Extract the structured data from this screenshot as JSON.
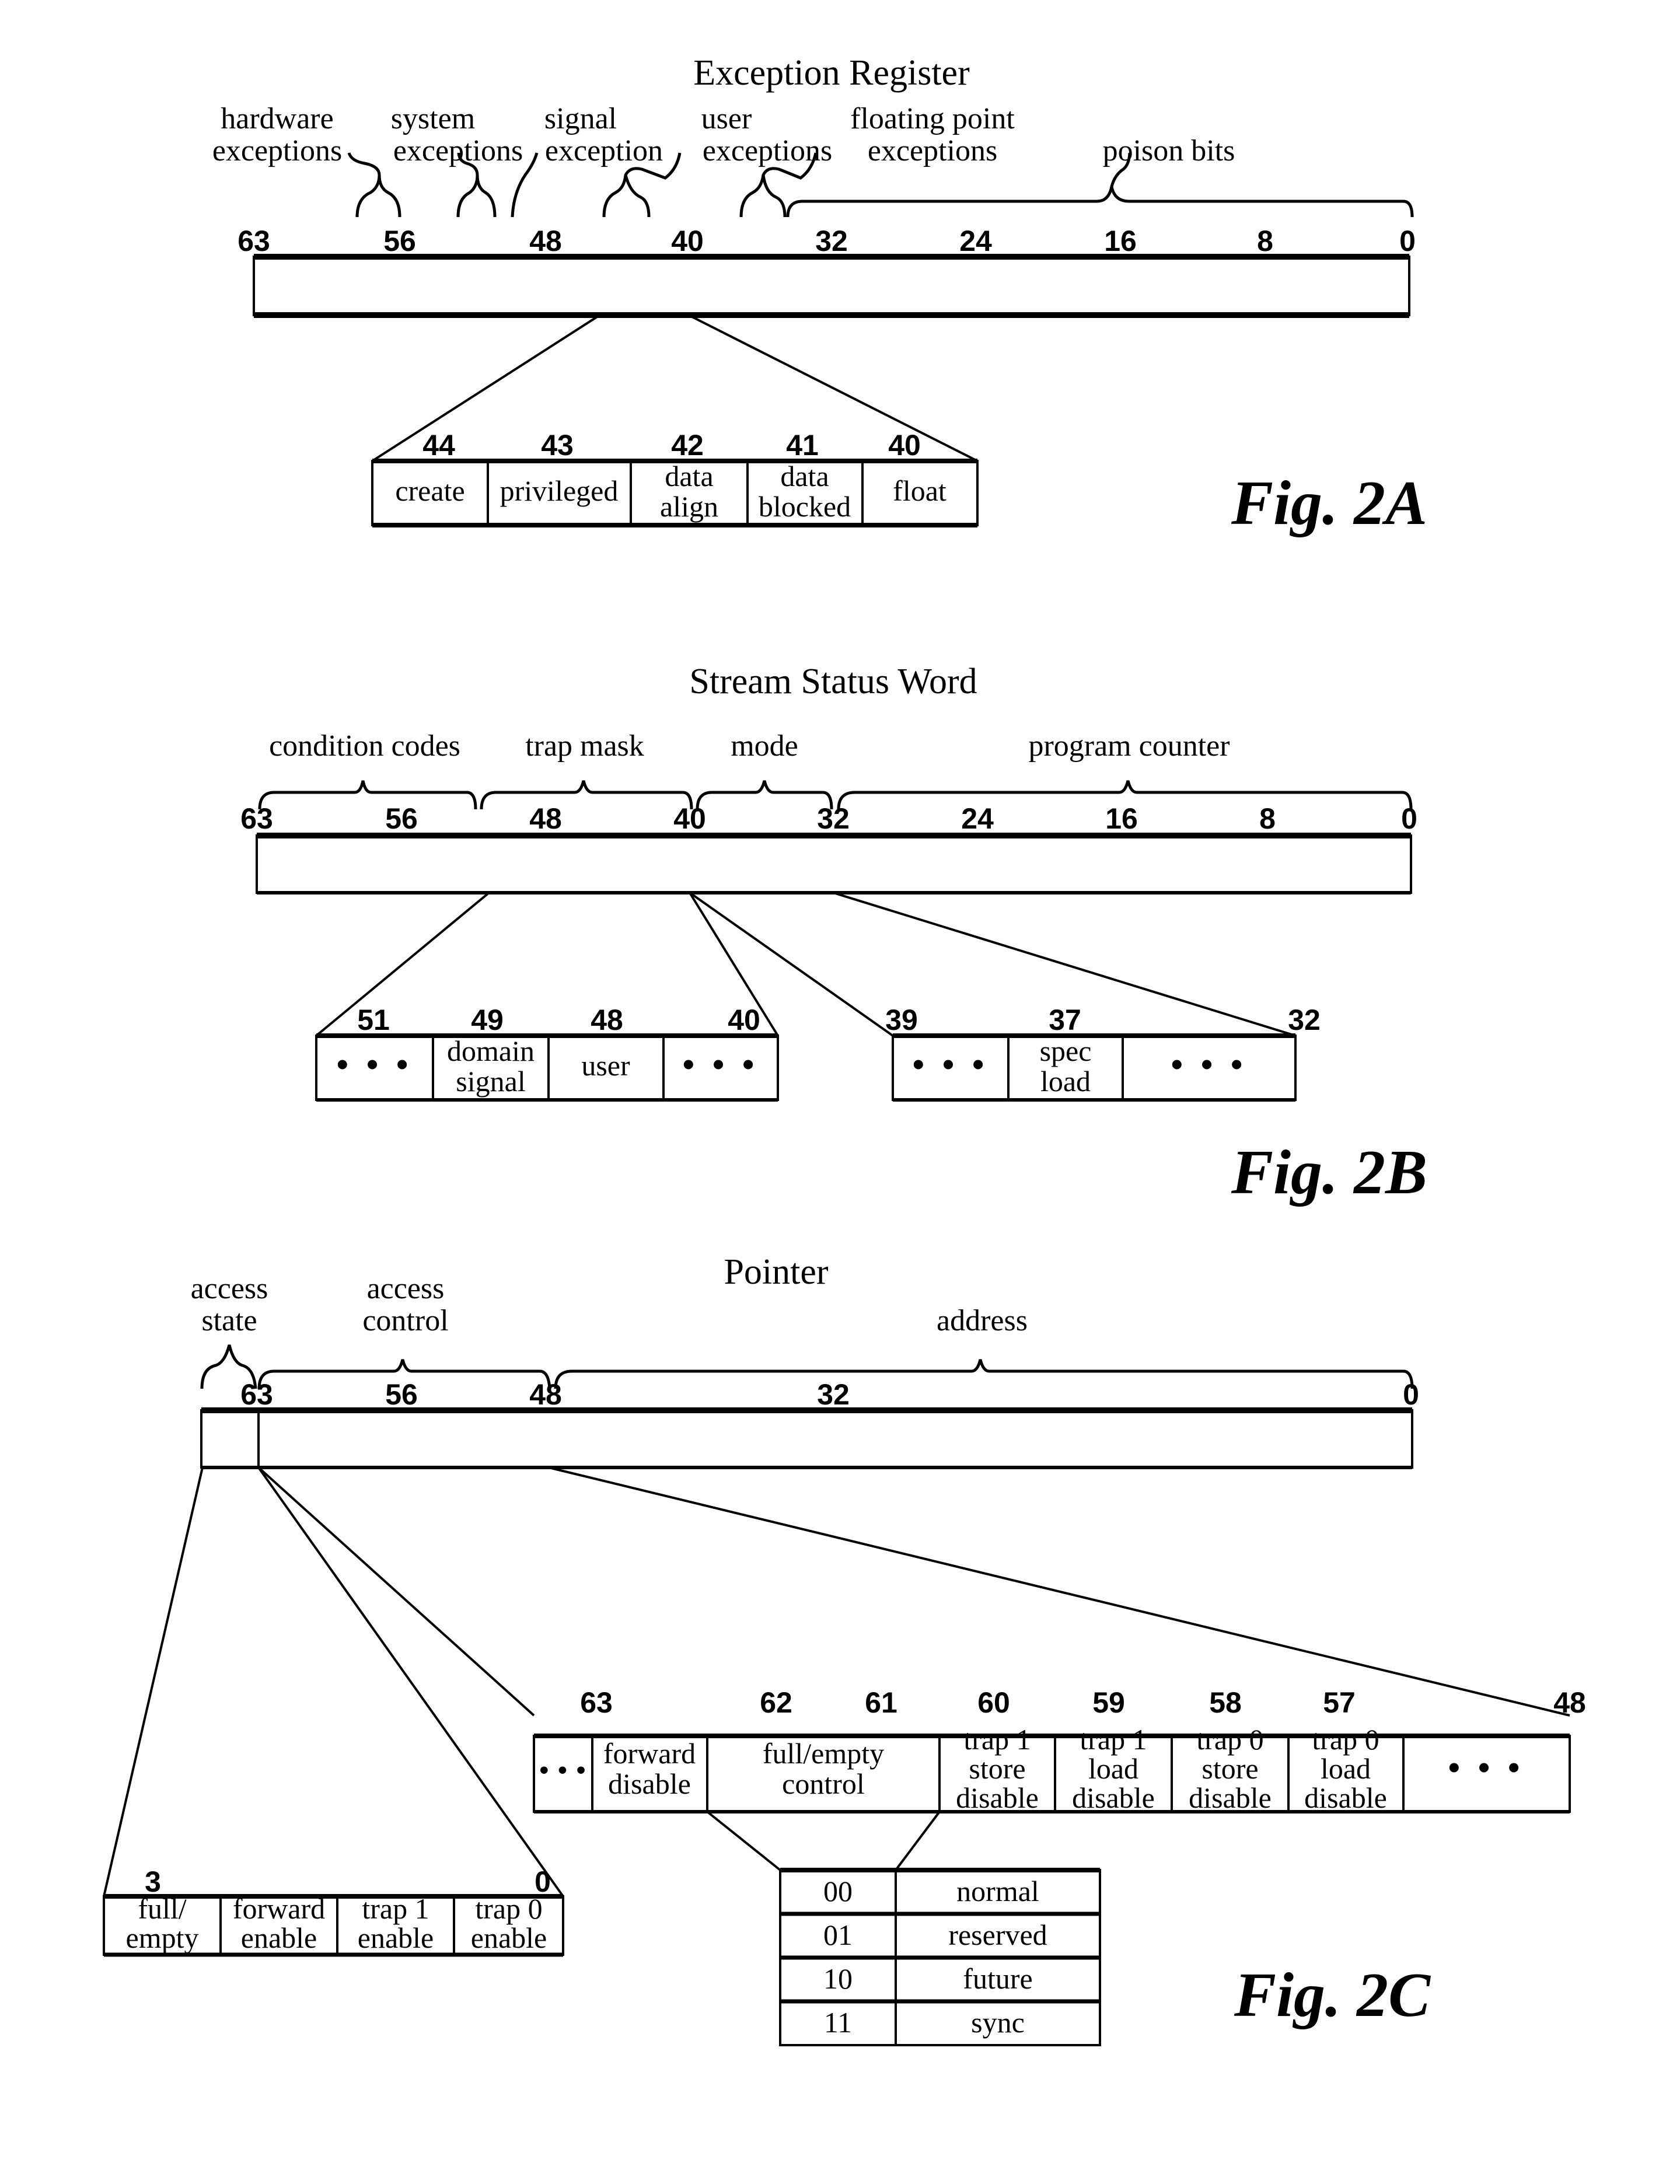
{
  "fig2a": {
    "title": "Exception Register",
    "caption": "Fig. 2A",
    "field_labels": [
      {
        "line1": "hardware",
        "line2": "exceptions"
      },
      {
        "line1": "system",
        "line2": "exceptions"
      },
      {
        "line1": "signal",
        "line2": "exception"
      },
      {
        "line1": "user",
        "line2": "exceptions"
      },
      {
        "line1": "floating point",
        "line2": "exceptions"
      },
      {
        "line1": "",
        "line2": "poison bits"
      }
    ],
    "bit_ticks": [
      "63",
      "56",
      "48",
      "40",
      "32",
      "24",
      "16",
      "8",
      "0"
    ],
    "detail": {
      "bits": [
        "44",
        "43",
        "42",
        "41",
        "40"
      ],
      "cells": [
        {
          "line1": "create",
          "line2": ""
        },
        {
          "line1": "privileged",
          "line2": ""
        },
        {
          "line1": "data",
          "line2": "align"
        },
        {
          "line1": "data",
          "line2": "blocked"
        },
        {
          "line1": "float",
          "line2": ""
        }
      ]
    }
  },
  "fig2b": {
    "title": "Stream Status Word",
    "caption": "Fig. 2B",
    "field_labels": [
      "condition codes",
      "trap mask",
      "mode",
      "program counter"
    ],
    "bit_ticks": [
      "63",
      "56",
      "48",
      "40",
      "32",
      "24",
      "16",
      "8",
      "0"
    ],
    "detail_left": {
      "bits": [
        "51",
        "49",
        "48",
        "40"
      ],
      "cells": [
        {
          "line1": "• • •",
          "line2": ""
        },
        {
          "line1": "domain",
          "line2": "signal"
        },
        {
          "line1": "user",
          "line2": ""
        },
        {
          "line1": "• • •",
          "line2": ""
        }
      ]
    },
    "detail_right": {
      "bits": [
        "39",
        "37",
        "32"
      ],
      "cells": [
        {
          "line1": "• • •",
          "line2": ""
        },
        {
          "line1": "spec",
          "line2": "load"
        },
        {
          "line1": "• • •",
          "line2": ""
        }
      ]
    }
  },
  "fig2c": {
    "title": "Pointer",
    "caption": "Fig. 2C",
    "field_labels": [
      {
        "line1": "access",
        "line2": "state"
      },
      {
        "line1": "access",
        "line2": "control"
      },
      {
        "line1": "",
        "line2": "address"
      }
    ],
    "bit_ticks": [
      "63",
      "56",
      "48",
      "32",
      "0"
    ],
    "access_control_detail": {
      "bits": [
        "63",
        "62",
        "61",
        "60",
        "59",
        "58",
        "57",
        "48"
      ],
      "cells": [
        {
          "line1": "• • •",
          "line2": "",
          "line3": ""
        },
        {
          "line1": "forward",
          "line2": "disable",
          "line3": ""
        },
        {
          "line1": "full/empty",
          "line2": "control",
          "line3": ""
        },
        {
          "line1": "trap 1",
          "line2": "store",
          "line3": "disable"
        },
        {
          "line1": "trap 1",
          "line2": "load",
          "line3": "disable"
        },
        {
          "line1": "trap 0",
          "line2": "store",
          "line3": "disable"
        },
        {
          "line1": "trap 0",
          "line2": "load",
          "line3": "disable"
        },
        {
          "line1": "• • •",
          "line2": "",
          "line3": ""
        }
      ]
    },
    "access_state_detail": {
      "bits": [
        "3",
        "0"
      ],
      "cells": [
        {
          "line1": "full/",
          "line2": "empty"
        },
        {
          "line1": "forward",
          "line2": "enable"
        },
        {
          "line1": "trap 1",
          "line2": "enable"
        },
        {
          "line1": "trap 0",
          "line2": "enable"
        }
      ]
    },
    "full_empty_table": [
      {
        "code": "00",
        "meaning": "normal"
      },
      {
        "code": "01",
        "meaning": "reserved"
      },
      {
        "code": "10",
        "meaning": "future"
      },
      {
        "code": "11",
        "meaning": "sync"
      }
    ]
  }
}
